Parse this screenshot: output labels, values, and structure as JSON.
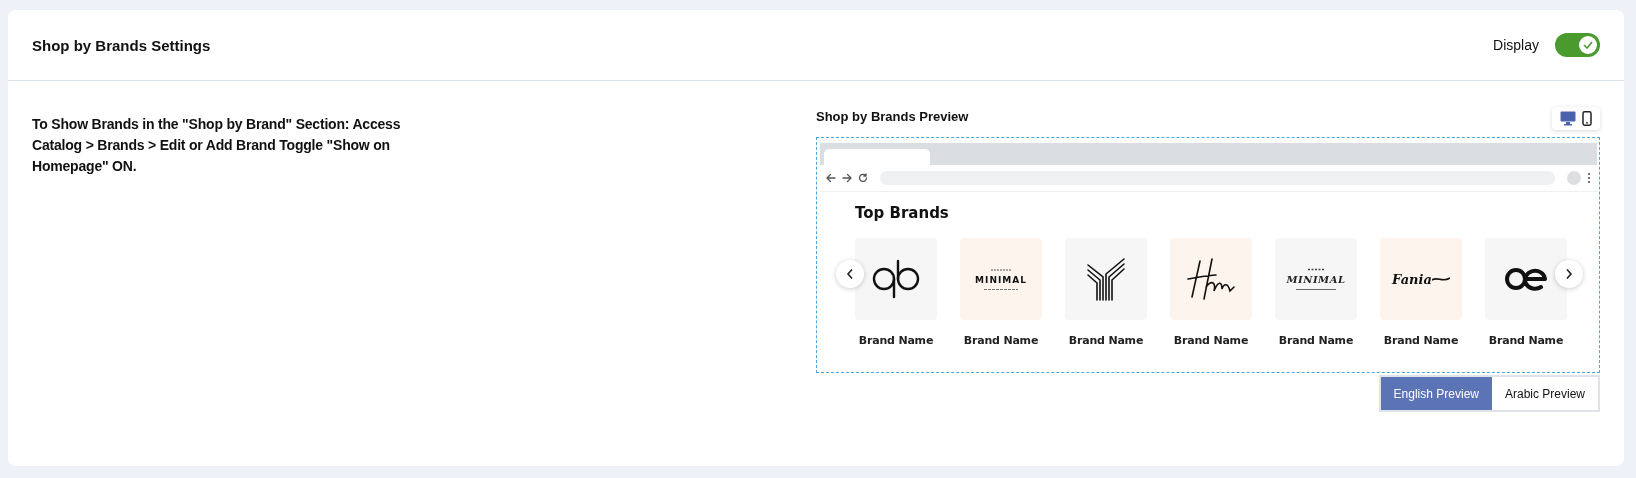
{
  "header": {
    "title": "Shop by Brands Settings",
    "display_label": "Display",
    "display_on": true
  },
  "instructions": "To Show Brands in the \"Shop by Brand\" Section: Access Catalog > Brands > Edit or Add Brand Toggle \"Show on Homepage\" ON.",
  "preview": {
    "title": "Shop by Brands Preview",
    "devices": [
      {
        "kind": "desktop",
        "selected": true
      },
      {
        "kind": "mobile",
        "selected": false
      }
    ],
    "section_title": "Top Brands",
    "brands": [
      {
        "name": "Brand Name",
        "kind": "loops"
      },
      {
        "name": "Brand Name",
        "kind": "wordmark",
        "logo_text": "MINIMAL"
      },
      {
        "name": "Brand Name",
        "kind": "stripes"
      },
      {
        "name": "Brand Name",
        "kind": "signature"
      },
      {
        "name": "Brand Name",
        "kind": "scriptmark",
        "logo_text": "MINIMAL"
      },
      {
        "name": "Brand Name",
        "kind": "script",
        "logo_text": "Fania"
      },
      {
        "name": "Brand Name",
        "kind": "rings"
      }
    ],
    "languages": [
      {
        "label": "English Preview",
        "selected": true
      },
      {
        "label": "Arabic Preview",
        "selected": false
      }
    ]
  }
}
